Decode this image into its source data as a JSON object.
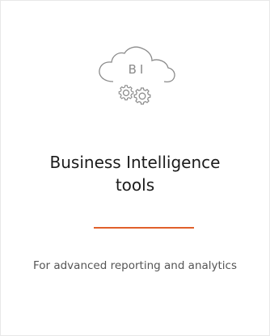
{
  "card": {
    "icon": {
      "name": "cloud-gear-icon",
      "label": "BI"
    },
    "title_line1": "Business Intelligence",
    "title_line2": "tools",
    "divider_color": "#e0602a",
    "description": "For advanced reporting and analytics"
  }
}
